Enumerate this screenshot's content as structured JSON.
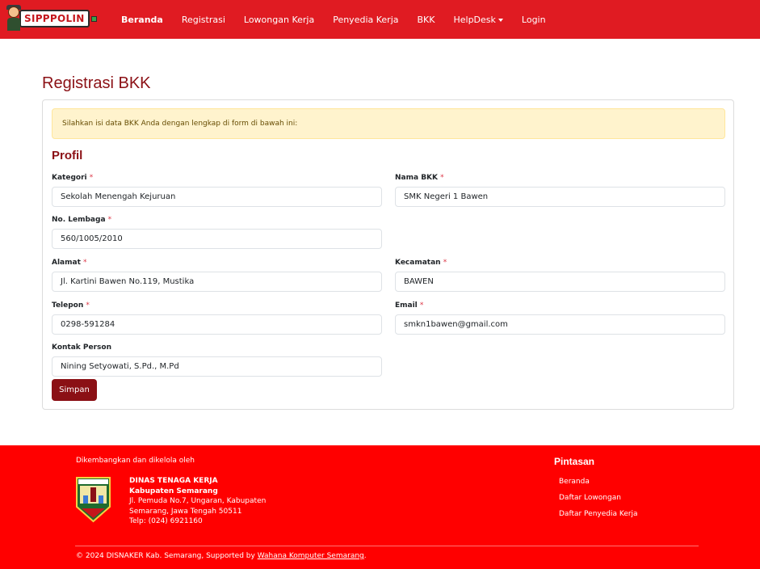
{
  "brand": {
    "name": "SIPPPOLIN"
  },
  "nav": {
    "items": [
      {
        "label": "Beranda"
      },
      {
        "label": "Registrasi"
      },
      {
        "label": "Lowongan Kerja"
      },
      {
        "label": "Penyedia Kerja"
      },
      {
        "label": "BKK"
      },
      {
        "label": "HelpDesk"
      },
      {
        "label": "Login"
      }
    ]
  },
  "page": {
    "title": "Registrasi BKK"
  },
  "alert": {
    "text": "Silahkan isi data BKK Anda dengan lengkap di form di bawah ini:"
  },
  "section": {
    "title": "Profil"
  },
  "form": {
    "required_mark": "*",
    "kategori": {
      "label": "Kategori",
      "value": "Sekolah Menengah Kejuruan"
    },
    "nama_bkk": {
      "label": "Nama BKK",
      "value": "SMK Negeri 1 Bawen"
    },
    "no_lembaga": {
      "label": "No. Lembaga",
      "value": "560/1005/2010"
    },
    "alamat": {
      "label": "Alamat",
      "value": "Jl. Kartini Bawen No.119, Mustika"
    },
    "kecamatan": {
      "label": "Kecamatan",
      "value": "BAWEN"
    },
    "telepon": {
      "label": "Telepon",
      "value": "0298-591284"
    },
    "email": {
      "label": "Email",
      "value": "smkn1bawen@gmail.com"
    },
    "kontak_person": {
      "label": "Kontak Person",
      "value": "Nining Setyowati, S.Pd., M.Pd"
    },
    "submit_label": "Simpan"
  },
  "footer": {
    "developed_by": "Dikembangkan dan dikelola oleh",
    "org_name": "DINAS TENAGA KERJA",
    "org_region": "Kabupaten Semarang",
    "address_line1": "Jl. Pemuda No.7, Ungaran, Kabupaten",
    "address_line2": "Semarang, Jawa Tengah 50511",
    "phone": "Telp: (024) 6921160",
    "logo_caption": "KABUPATEN SEMARANG",
    "shortcuts_title": "Pintasan",
    "shortcuts": [
      {
        "label": "Beranda"
      },
      {
        "label": "Daftar Lowongan"
      },
      {
        "label": "Daftar Penyedia Kerja"
      }
    ],
    "copyright_prefix": "© 2024 DISNAKER Kab. Semarang, Supported by ",
    "copyright_link": "Wahana Komputer Semarang",
    "copyright_suffix": "."
  },
  "colors": {
    "navbar": "#e01b22",
    "footer": "#ff0000",
    "accent": "#8b1015",
    "alert_bg": "#fff3cd",
    "required": "#dc3545"
  },
  "icons": [
    "mascot-logo-icon",
    "caret-down-icon",
    "kabupaten-semarang-emblem-icon"
  ]
}
